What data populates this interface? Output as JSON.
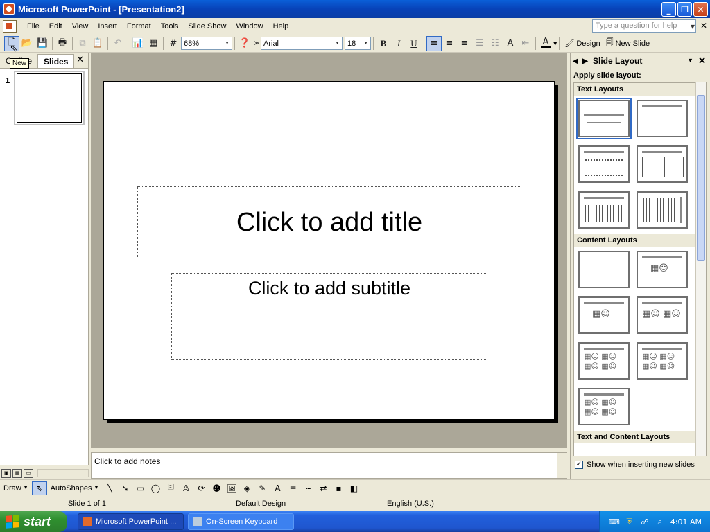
{
  "window": {
    "title": "Microsoft PowerPoint - [Presentation2]"
  },
  "menu": {
    "items": [
      "File",
      "Edit",
      "View",
      "Insert",
      "Format",
      "Tools",
      "Slide Show",
      "Window",
      "Help"
    ],
    "help_placeholder": "Type a question for help"
  },
  "toolbar": {
    "zoom": "68%",
    "font": "Arial",
    "font_size": "18",
    "bold": "B",
    "italic": "I",
    "underline": "U",
    "font_color_label": "A",
    "design_label": "Design",
    "new_slide_label": "New Slide",
    "tooltip": "New"
  },
  "left_panel": {
    "tabs": [
      "Outline",
      "Slides"
    ],
    "active_tab": "Slides",
    "slide_number": "1"
  },
  "slide": {
    "title_placeholder": "Click to add title",
    "subtitle_placeholder": "Click to add subtitle"
  },
  "notes": {
    "placeholder": "Click to add notes"
  },
  "task_pane": {
    "title": "Slide Layout",
    "apply_label": "Apply slide layout:",
    "groups": [
      "Text Layouts",
      "Content Layouts",
      "Text and Content Layouts"
    ],
    "show_checkbox_label": "Show when inserting new slides",
    "show_checkbox_checked": true
  },
  "drawing_toolbar": {
    "draw_label": "Draw",
    "autoshapes_label": "AutoShapes"
  },
  "status_bar": {
    "slide_info": "Slide 1 of 1",
    "design": "Default Design",
    "language": "English (U.S.)"
  },
  "taskbar": {
    "start_label": "start",
    "tasks": [
      "Microsoft PowerPoint ...",
      "On-Screen Keyboard"
    ],
    "clock": "4:01 AM"
  },
  "colors": {
    "title_bar": "#0a5fd8",
    "taskbar": "#2260dc",
    "start_button": "#2f8f2f",
    "canvas_bg": "#aba798",
    "selection": "#316ac5"
  }
}
